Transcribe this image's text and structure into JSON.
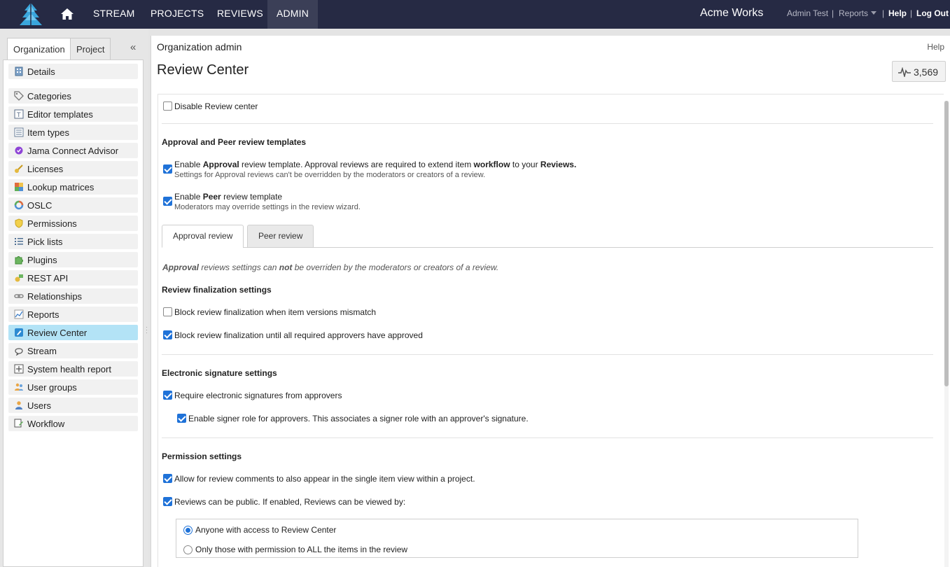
{
  "topnav": {
    "items": [
      "STREAM",
      "PROJECTS",
      "REVIEWS",
      "ADMIN"
    ],
    "brand": "Acme Works",
    "user": "Admin Test",
    "separator": "|",
    "reports": "Reports",
    "help": "Help",
    "logout": "Log Out",
    "icons": [
      "jama-logo-icon",
      "home-icon"
    ]
  },
  "sidebar": {
    "tabs": [
      "Organization",
      "Project"
    ],
    "collapse": "«",
    "items": [
      {
        "label": "Details",
        "icon": "building-icon"
      },
      {
        "label": "Categories",
        "icon": "tag-icon"
      },
      {
        "label": "Editor templates",
        "icon": "template-icon"
      },
      {
        "label": "Item types",
        "icon": "item-types-icon"
      },
      {
        "label": "Jama Connect Advisor",
        "icon": "advisor-icon"
      },
      {
        "label": "Licenses",
        "icon": "key-icon"
      },
      {
        "label": "Lookup matrices",
        "icon": "matrix-icon"
      },
      {
        "label": "OSLC",
        "icon": "oslc-icon"
      },
      {
        "label": "Permissions",
        "icon": "shield-icon"
      },
      {
        "label": "Pick lists",
        "icon": "list-icon"
      },
      {
        "label": "Plugins",
        "icon": "puzzle-icon"
      },
      {
        "label": "REST API",
        "icon": "api-icon"
      },
      {
        "label": "Relationships",
        "icon": "link-icon"
      },
      {
        "label": "Reports",
        "icon": "chart-icon"
      },
      {
        "label": "Review Center",
        "icon": "review-icon"
      },
      {
        "label": "Stream",
        "icon": "stream-icon"
      },
      {
        "label": "System health report",
        "icon": "health-icon"
      },
      {
        "label": "User groups",
        "icon": "user-group-icon"
      },
      {
        "label": "Users",
        "icon": "user-icon"
      },
      {
        "label": "Workflow",
        "icon": "workflow-icon"
      }
    ],
    "selected": "Review Center"
  },
  "main": {
    "breadcrumb": "Organization admin",
    "help": "Help",
    "title": "Review Center",
    "counter": "3,569",
    "disable": {
      "label": "Disable Review center",
      "checked": false
    },
    "templates_heading": "Approval and Peer review templates",
    "approval_enable": {
      "pre": "Enable ",
      "b1": "Approval",
      "mid": " review template. Approval reviews are required to extend item ",
      "b2": "workflow",
      "post": " to your ",
      "b3": "Reviews.",
      "sub": "Settings for Approval reviews can't be overridden by the moderators or creators of a review.",
      "checked": true
    },
    "peer_enable": {
      "pre": "Enable ",
      "b1": "Peer",
      "post": " review template",
      "sub": "Moderators may override settings in the review wizard.",
      "checked": true
    },
    "tabs": [
      "Approval review",
      "Peer review"
    ],
    "note": {
      "b1": "Approval",
      "mid": " reviews settings can ",
      "b2": "not",
      "post": " be overriden by the moderators or creators of a review."
    },
    "finalization_heading": "Review finalization settings",
    "block_mismatch": {
      "label": "Block review finalization when item versions mismatch",
      "checked": false
    },
    "block_approvers": {
      "label": "Block review finalization until all required approvers have approved",
      "checked": true
    },
    "esig_heading": "Electronic signature settings",
    "require_esig": {
      "label": "Require electronic signatures from approvers",
      "checked": true
    },
    "signer_role": {
      "label": "Enable signer role for approvers. This associates a signer role with an approver's signature.",
      "checked": true
    },
    "perm_heading": "Permission settings",
    "allow_comments": {
      "label": "Allow for review comments to also appear in the single item view within a project.",
      "checked": true
    },
    "public": {
      "label": "Reviews can be public. If enabled, Reviews can be viewed by:",
      "checked": true
    },
    "radio_options": [
      {
        "label": "Anyone with access to Review Center",
        "selected": true
      },
      {
        "label": "Only those with permission to ALL the items in the review",
        "selected": false
      }
    ]
  }
}
